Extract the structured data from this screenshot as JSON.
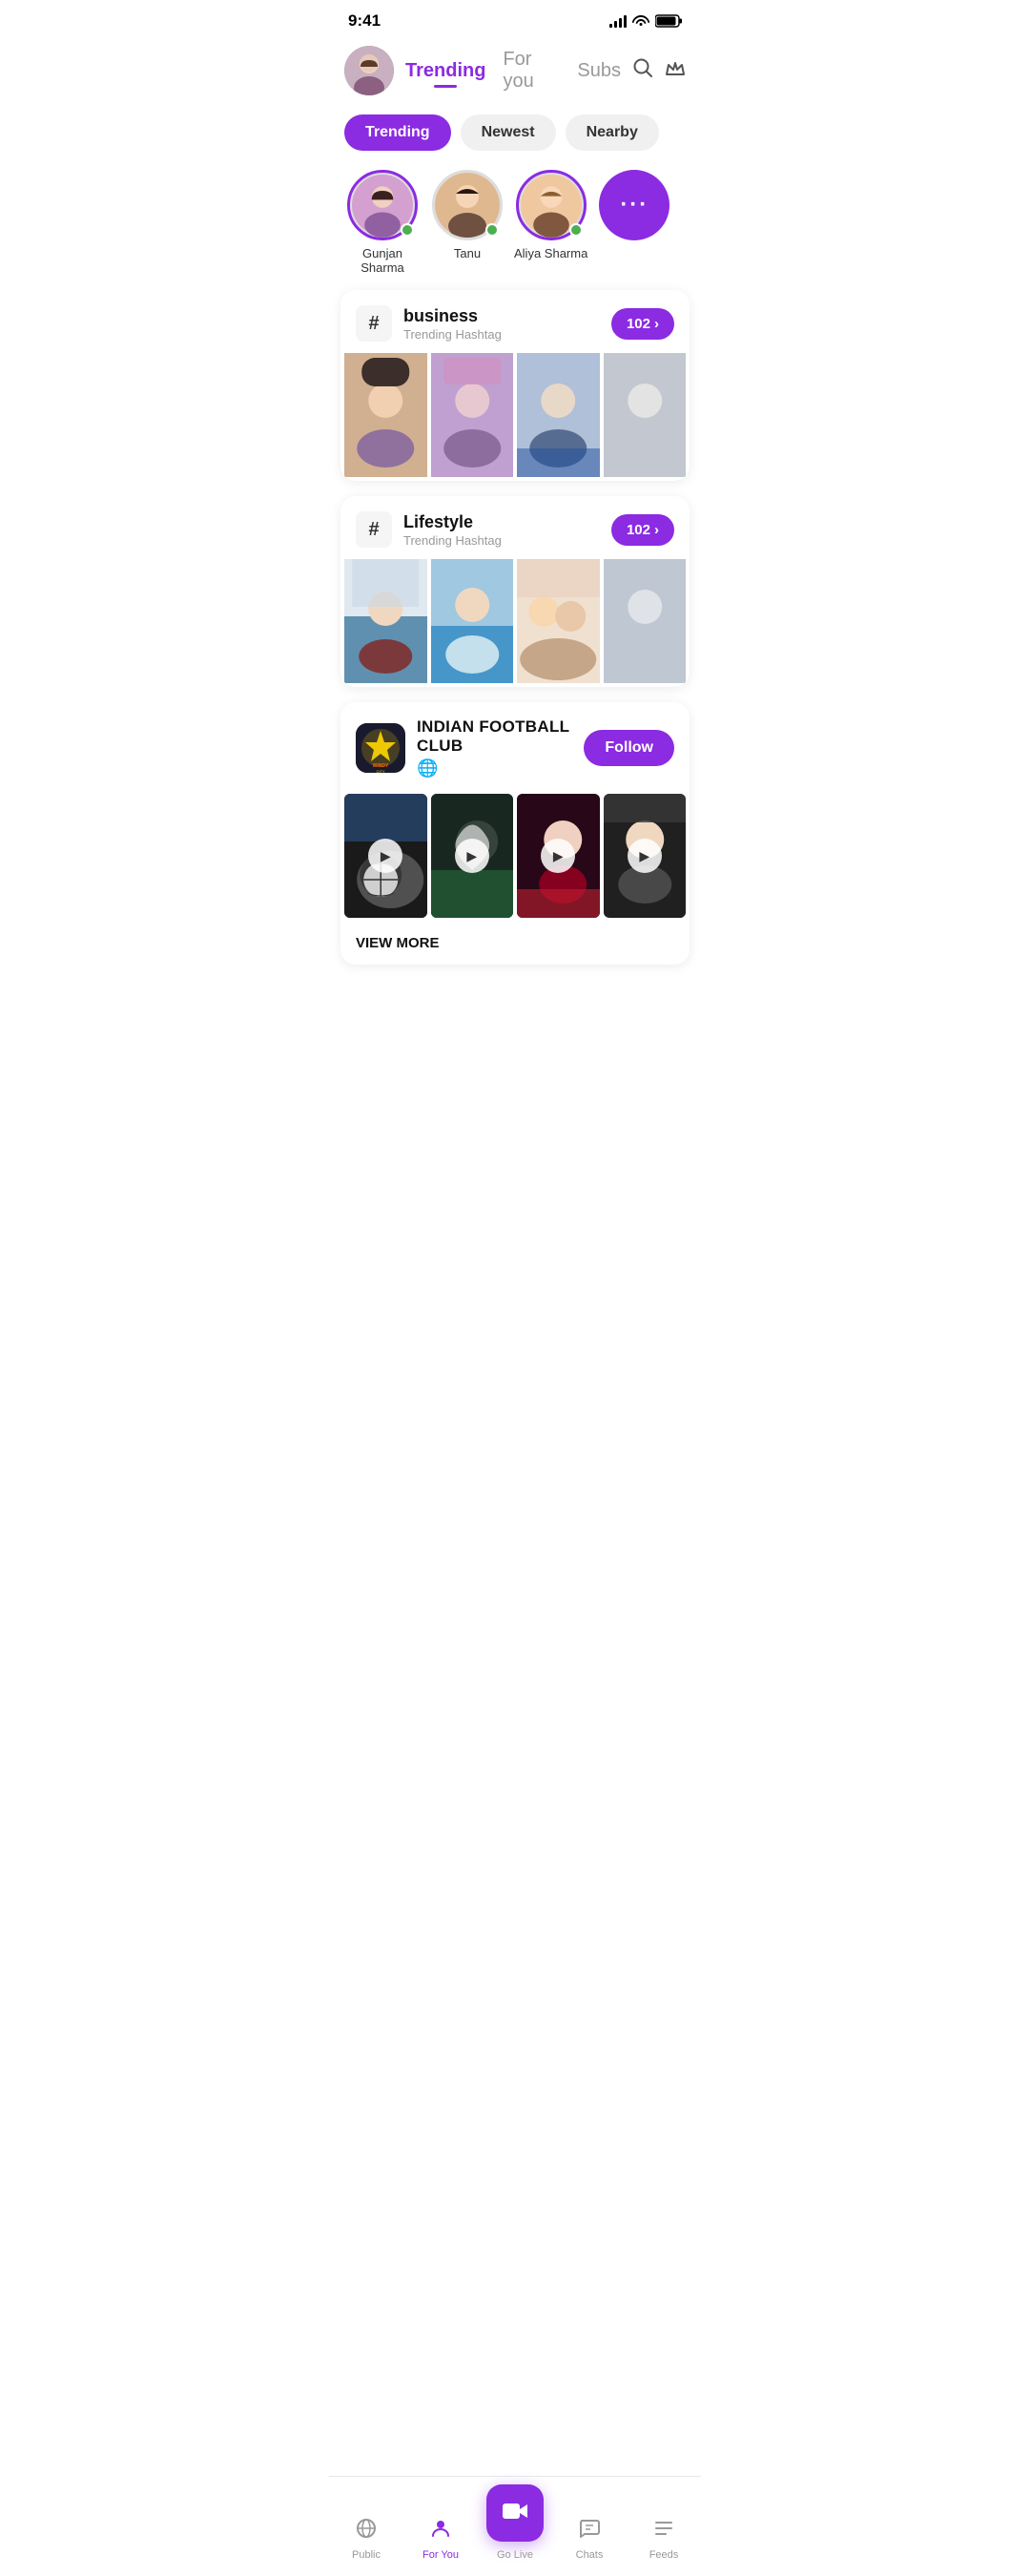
{
  "statusBar": {
    "time": "9:41",
    "signalBars": [
      4,
      6,
      9,
      12,
      14
    ],
    "batteryLevel": 80
  },
  "header": {
    "tabs": [
      {
        "id": "trending",
        "label": "Trending",
        "active": true
      },
      {
        "id": "foryou",
        "label": "For you",
        "active": false
      },
      {
        "id": "subs",
        "label": "Subs",
        "active": false
      }
    ],
    "searchIcon": "🔍",
    "crownIcon": "👑"
  },
  "filterTabs": [
    {
      "id": "trending",
      "label": "Trending",
      "active": true
    },
    {
      "id": "newest",
      "label": "Newest",
      "active": false
    },
    {
      "id": "nearby",
      "label": "Nearby",
      "active": false
    }
  ],
  "stories": [
    {
      "id": "gunjan",
      "name": "Gunjan Sharma",
      "online": true,
      "hasRing": true
    },
    {
      "id": "tanu",
      "name": "Tanu",
      "online": true,
      "hasRing": false
    },
    {
      "id": "aliya",
      "name": "Aliya Sharma",
      "online": true,
      "hasRing": true
    }
  ],
  "storiesMoreLabel": "...",
  "hashtagCards": [
    {
      "id": "business",
      "symbol": "#",
      "title": "business",
      "subtitle": "Trending Hashtag",
      "count": "102",
      "chevron": "›",
      "photos": [
        "ph-1",
        "ph-2",
        "ph-3",
        "ph-4"
      ]
    },
    {
      "id": "lifestyle",
      "symbol": "#",
      "title": "Lifestyle",
      "subtitle": "Trending Hashtag",
      "count": "102",
      "chevron": "›",
      "photos": [
        "ph-5",
        "ph-6",
        "ph-7",
        "ph-8"
      ]
    }
  ],
  "clubCard": {
    "name": "INDIAN FOOTBALL CLUB",
    "logoText": "WINDY city",
    "subIcon": "🌐",
    "followLabel": "Follow",
    "videos": [
      "vp-1",
      "vp-2",
      "vp-3",
      "vp-4"
    ],
    "viewMore": "VIEW MORE"
  },
  "bottomNav": {
    "items": [
      {
        "id": "public",
        "icon": "📡",
        "label": "Public",
        "active": false
      },
      {
        "id": "foryou",
        "icon": "👤",
        "label": "For You",
        "active": true
      },
      {
        "id": "golive",
        "icon": "🎥",
        "label": "Go Live",
        "active": false,
        "isCenter": true
      },
      {
        "id": "chats",
        "icon": "💬",
        "label": "Chats",
        "active": false
      },
      {
        "id": "feeds",
        "icon": "☰",
        "label": "Feeds",
        "active": false
      }
    ]
  }
}
